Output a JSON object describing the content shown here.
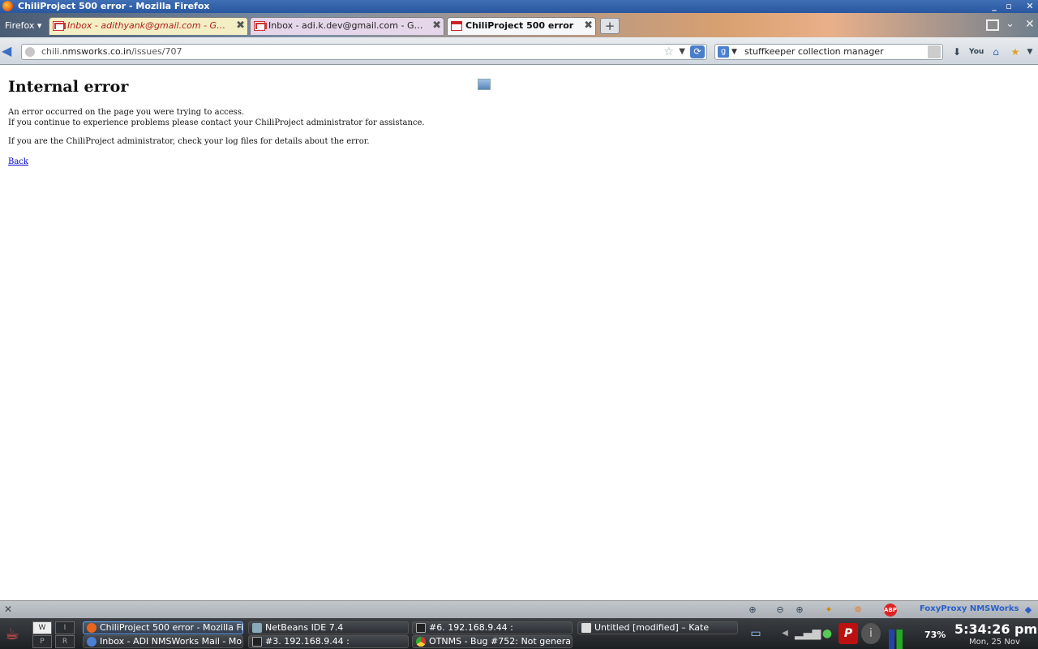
{
  "window": {
    "title": "ChiliProject 500 error - Mozilla Firefox"
  },
  "browser": {
    "menu_label": "Firefox",
    "tabs": [
      {
        "label": "Inbox - adithyank@gmail.com - Gmail",
        "active": false
      },
      {
        "label": "Inbox - adi.k.dev@gmail.com - Gmail",
        "active": false
      },
      {
        "label": "ChiliProject 500 error",
        "active": true
      }
    ],
    "url": {
      "prefix": "chili.",
      "host": "nmsworks.co.in",
      "path": "/issues/707"
    },
    "search": {
      "value": "stuffkeeper collection manager"
    }
  },
  "page": {
    "heading": "Internal error",
    "line1": "An error occurred on the page you were trying to access.",
    "line2": "If you continue to experience problems please contact your ChiliProject administrator for assistance.",
    "line3": "If you are the ChiliProject administrator, check your log files for details about the error.",
    "back_link": "Back"
  },
  "addon_bar": {
    "foxyproxy_label": "FoxyProxy NMSWorks"
  },
  "taskbar": {
    "pager": [
      "W",
      "I",
      "P",
      "R"
    ],
    "tasks_row1": [
      {
        "label": "ChiliProject 500 error - Mozilla Fi",
        "active": true
      },
      {
        "label": "NetBeans IDE 7.4",
        "active": false
      },
      {
        "label": "#6. 192.168.9.44 :",
        "active": false
      },
      {
        "label": "Untitled [modified] – Kate",
        "active": false
      }
    ],
    "tasks_row2": [
      {
        "label": "Inbox - ADI NMSWorks Mail - Mo",
        "active": false
      },
      {
        "label": "#3. 192.168.9.44 :",
        "active": false
      },
      {
        "label": "OTNMS - Bug #752: Not genera",
        "active": false
      }
    ],
    "battery": "73%",
    "clock": "5:34:26 pm",
    "date": "Mon, 25 Nov"
  }
}
